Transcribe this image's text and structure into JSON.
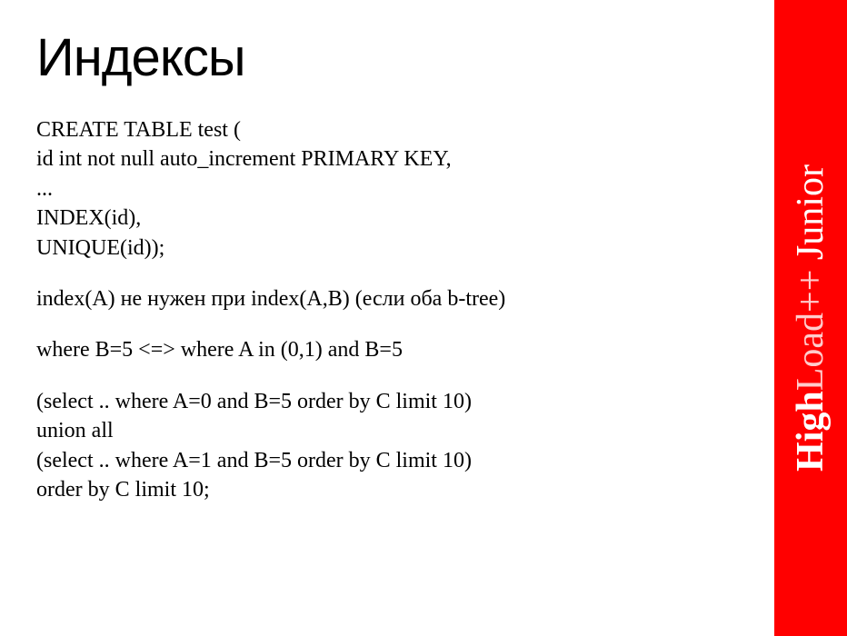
{
  "slide": {
    "title": "Индексы",
    "lines": [
      "CREATE TABLE test (",
      "id int not null auto_increment PRIMARY KEY,",
      "...",
      "INDEX(id),",
      "UNIQUE(id));",
      "",
      "index(A) не нужен при index(A,B) (если оба b-tree)",
      "",
      "where B=5 <=> where A in (0,1) and B=5",
      "",
      "(select .. where A=0 and B=5 order by C limit 10)",
      "union all",
      "(select .. where A=1 and B=5 order by C limit 10)",
      "order by C limit 10;"
    ]
  },
  "sidebar": {
    "brand_bold": "High",
    "brand_light": "Load++",
    "brand_suffix": " Junior"
  }
}
